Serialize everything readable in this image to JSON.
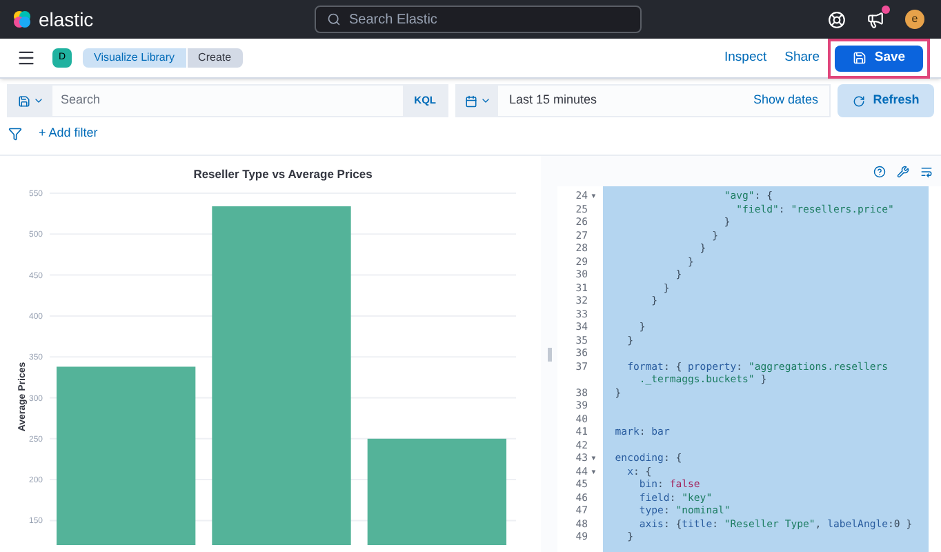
{
  "header": {
    "logo": "elastic",
    "search_placeholder": "Search Elastic",
    "avatar": "e",
    "notification": true
  },
  "appbar": {
    "space": "D",
    "breadcrumbs": [
      {
        "label": "Visualize Library",
        "selected": false
      },
      {
        "label": "Create",
        "selected": true
      }
    ],
    "links": [
      "Inspect",
      "Share"
    ],
    "save": "Save",
    "save_highlighted": true
  },
  "query": {
    "placeholder": "Search",
    "language": "KQL",
    "time": "Last 15 minutes",
    "show_dates": "Show dates",
    "refresh": "Refresh"
  },
  "filter": {
    "add": "+ Add filter"
  },
  "chart": {
    "chart_data": {
      "type": "bar",
      "title": "Reseller Type vs Average Prices",
      "ylabel": "Average Prices",
      "values": [
        338,
        534,
        250
      ],
      "grid": true,
      "ylim": [
        120,
        550
      ],
      "yticks": [
        150,
        200,
        250,
        300,
        350,
        400,
        450,
        500,
        550
      ]
    }
  },
  "editor": {
    "lines": [
      {
        "num": "24",
        "fold": "▾",
        "tokens": [
          {
            "t": "                    \"avg\"",
            "kind": "string"
          },
          {
            "t": ": {",
            "kind": "plain"
          }
        ]
      },
      {
        "num": "25",
        "tokens": [
          {
            "t": "                      \"field\"",
            "kind": "string"
          },
          {
            "t": ": ",
            "kind": "plain"
          },
          {
            "t": "\"resellers.price\"",
            "kind": "string"
          }
        ]
      },
      {
        "num": "26",
        "tokens": [
          {
            "t": "                    }",
            "kind": "plain"
          }
        ]
      },
      {
        "num": "27",
        "tokens": [
          {
            "t": "                  }",
            "kind": "plain"
          }
        ]
      },
      {
        "num": "28",
        "tokens": [
          {
            "t": "                }",
            "kind": "plain"
          }
        ]
      },
      {
        "num": "29",
        "tokens": [
          {
            "t": "              }",
            "kind": "plain"
          }
        ]
      },
      {
        "num": "30",
        "tokens": [
          {
            "t": "            }",
            "kind": "plain"
          }
        ]
      },
      {
        "num": "31",
        "tokens": [
          {
            "t": "          }",
            "kind": "plain"
          }
        ]
      },
      {
        "num": "32",
        "tokens": [
          {
            "t": "        }",
            "kind": "plain"
          }
        ]
      },
      {
        "num": "33"
      },
      {
        "num": "34",
        "tokens": [
          {
            "t": "      }",
            "kind": "plain"
          }
        ]
      },
      {
        "num": "35",
        "tokens": [
          {
            "t": "    }",
            "kind": "plain"
          }
        ]
      },
      {
        "num": "36"
      },
      {
        "num": "37",
        "tokens": [
          {
            "t": "    format",
            "kind": "key"
          },
          {
            "t": ": { ",
            "kind": "plain"
          },
          {
            "t": "property",
            "kind": "key"
          },
          {
            "t": ": ",
            "kind": "plain"
          },
          {
            "t": "\"aggregations.resellers",
            "kind": "string"
          }
        ]
      },
      {
        "tokens": [
          {
            "t": "      ._termaggs.buckets\"",
            "kind": "string"
          },
          {
            "t": " }",
            "kind": "plain"
          }
        ]
      },
      {
        "num": "38",
        "tokens": [
          {
            "t": "  }",
            "kind": "plain"
          }
        ]
      },
      {
        "num": "39"
      },
      {
        "num": "40"
      },
      {
        "num": "41",
        "tokens": [
          {
            "t": "  mark",
            "kind": "key"
          },
          {
            "t": ": ",
            "kind": "plain"
          },
          {
            "t": "bar",
            "kind": "key"
          }
        ]
      },
      {
        "num": "42"
      },
      {
        "num": "43",
        "fold": "▾",
        "tokens": [
          {
            "t": "  encoding",
            "kind": "key"
          },
          {
            "t": ": {",
            "kind": "plain"
          }
        ]
      },
      {
        "num": "44",
        "fold": "▾",
        "tokens": [
          {
            "t": "    x",
            "kind": "key"
          },
          {
            "t": ": {",
            "kind": "plain"
          }
        ]
      },
      {
        "num": "45",
        "tokens": [
          {
            "t": "      bin",
            "kind": "key"
          },
          {
            "t": ": ",
            "kind": "plain"
          },
          {
            "t": "false",
            "kind": "keyword"
          }
        ]
      },
      {
        "num": "46",
        "tokens": [
          {
            "t": "      field",
            "kind": "key"
          },
          {
            "t": ": ",
            "kind": "plain"
          },
          {
            "t": "\"key\"",
            "kind": "string"
          }
        ]
      },
      {
        "num": "47",
        "tokens": [
          {
            "t": "      type",
            "kind": "key"
          },
          {
            "t": ": ",
            "kind": "plain"
          },
          {
            "t": "\"nominal\"",
            "kind": "string"
          }
        ]
      },
      {
        "num": "48",
        "tokens": [
          {
            "t": "      axis",
            "kind": "key"
          },
          {
            "t": ": {",
            "kind": "plain"
          },
          {
            "t": "title",
            "kind": "key"
          },
          {
            "t": ": ",
            "kind": "plain"
          },
          {
            "t": "\"Reseller Type\"",
            "kind": "string"
          },
          {
            "t": ", ",
            "kind": "plain"
          },
          {
            "t": "labelAngle",
            "kind": "key"
          },
          {
            "t": ":0 }",
            "kind": "plain"
          }
        ]
      },
      {
        "num": "49",
        "tokens": [
          {
            "t": "    }",
            "kind": "plain"
          }
        ]
      }
    ]
  }
}
